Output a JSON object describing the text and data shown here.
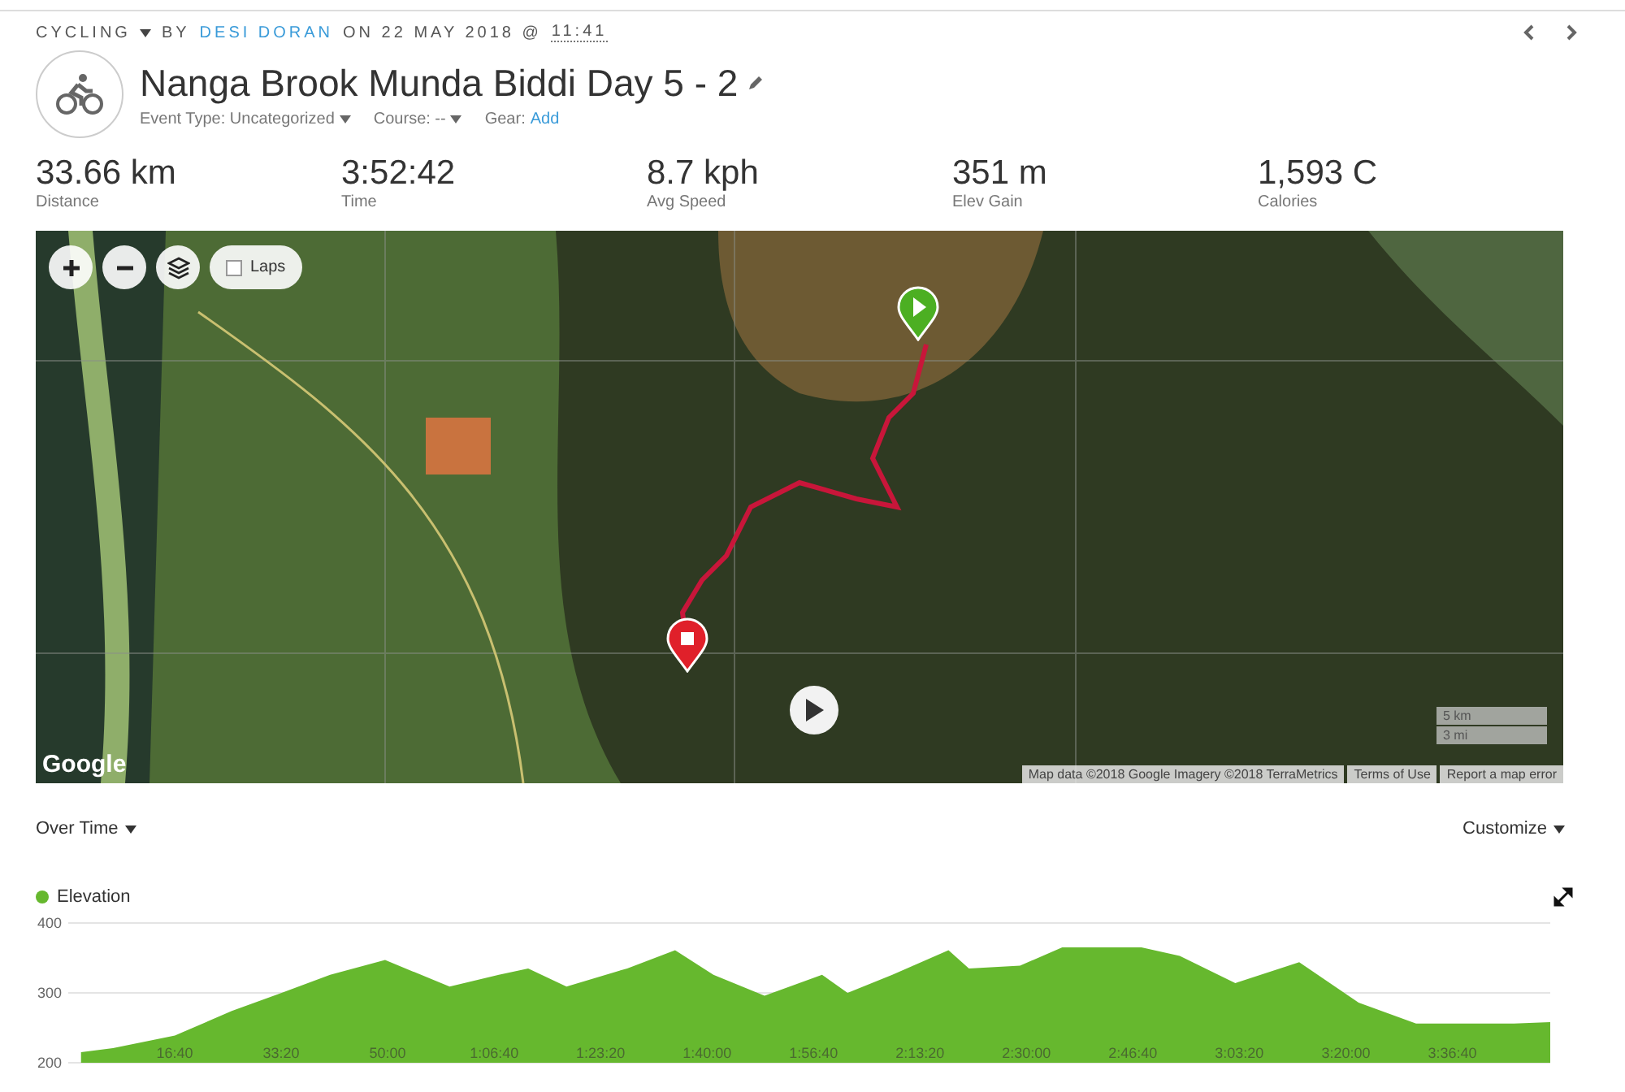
{
  "header": {
    "activity_type": "CYCLING",
    "byline": [
      {
        "kind": "plain",
        "text": "BY"
      },
      {
        "kind": "link",
        "text": "DESI DORAN"
      },
      {
        "kind": "plain",
        "text": "ON 22 MAY 2018 @"
      },
      {
        "kind": "time",
        "text": "11:41"
      }
    ]
  },
  "title": "Nanga Brook Munda Biddi Day 5 - 2",
  "meta": {
    "event_type": "Event Type: Uncategorized",
    "course": "Course: --",
    "gear_label": "Gear:",
    "gear_link": "Add"
  },
  "stats": [
    {
      "value": "33.66 km",
      "label": "Distance"
    },
    {
      "value": "3:52:42",
      "label": "Time"
    },
    {
      "value": "8.7 kph",
      "label": "Avg Speed"
    },
    {
      "value": "351 m",
      "label": "Elev Gain"
    },
    {
      "value": "1,593 C",
      "label": "Calories"
    }
  ],
  "map": {
    "laps": {
      "label": "Laps",
      "checked": false
    },
    "logo": "Google",
    "scale": [
      "5 km",
      "3 mi"
    ],
    "attribution": [
      "Map data ©2018 Google Imagery ©2018 TerraMetrics",
      "Terms of Use",
      "Report a map error"
    ]
  },
  "chart_panel": {
    "mode": "Over Time",
    "customize": "Customize",
    "legend": {
      "color": "#66b82e"
    },
    "chart_data": {
      "type": "area",
      "x": [
        2,
        7,
        16.7,
        25.6,
        33.4,
        41,
        49.6,
        59.7,
        67.4,
        72,
        78,
        87.5,
        95,
        101,
        109,
        118,
        122,
        129,
        137.8,
        141,
        149,
        155.6,
        168,
        174,
        182.7,
        192.7,
        202,
        211,
        217.5,
        226.3,
        232
      ],
      "series": [
        {
          "name": "Elevation",
          "color": "#66b82e",
          "values": [
            215,
            221,
            239,
            274,
            300,
            326,
            347,
            309,
            326,
            335,
            309,
            335,
            361,
            326,
            296,
            326,
            300,
            326,
            361,
            335,
            339,
            365,
            365,
            353,
            314,
            344,
            286,
            256,
            256,
            256,
            258
          ]
        }
      ],
      "xlim": [
        0,
        232
      ],
      "ylim": [
        200,
        400
      ],
      "yticks": [
        200,
        300,
        400
      ],
      "xticks": [
        {
          "value": 16.67,
          "label": "16:40"
        },
        {
          "value": 33.33,
          "label": "33:20"
        },
        {
          "value": 50,
          "label": "50:00"
        },
        {
          "value": 66.67,
          "label": "1:06:40"
        },
        {
          "value": 83.33,
          "label": "1:23:20"
        },
        {
          "value": 100,
          "label": "1:40:00"
        },
        {
          "value": 116.67,
          "label": "1:56:40"
        },
        {
          "value": 133.33,
          "label": "2:13:20"
        },
        {
          "value": 150,
          "label": "2:30:00"
        },
        {
          "value": 166.67,
          "label": "2:46:40"
        },
        {
          "value": 183.33,
          "label": "3:03:20"
        },
        {
          "value": 200,
          "label": "3:20:00"
        },
        {
          "value": 216.67,
          "label": "3:36:40"
        }
      ]
    }
  }
}
